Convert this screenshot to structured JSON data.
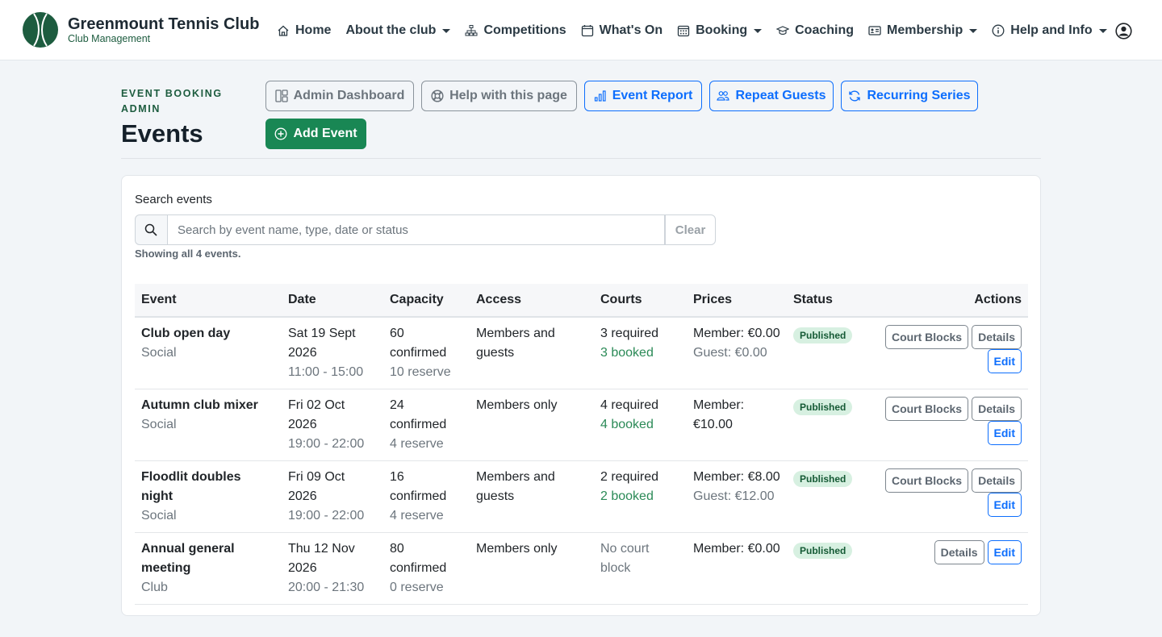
{
  "brand": {
    "title": "Greenmount Tennis Club",
    "subtitle": "Club Management"
  },
  "nav": [
    {
      "label": "Home",
      "icon": "home-icon",
      "dropdown": false
    },
    {
      "label": "About the club",
      "icon": "",
      "dropdown": true
    },
    {
      "label": "Competitions",
      "icon": "sitemap-icon",
      "dropdown": false
    },
    {
      "label": "What's On",
      "icon": "calendar-icon",
      "dropdown": false
    },
    {
      "label": "Booking",
      "icon": "calendar-grid-icon",
      "dropdown": true
    },
    {
      "label": "Coaching",
      "icon": "mortarboard-icon",
      "dropdown": false
    },
    {
      "label": "Membership",
      "icon": "id-card-icon",
      "dropdown": true
    },
    {
      "label": "Help and Info",
      "icon": "info-icon",
      "dropdown": true
    }
  ],
  "header": {
    "eyebrow": "EVENT BOOKING ADMIN",
    "title": "Events",
    "buttons": {
      "admin_dashboard": "Admin Dashboard",
      "help": "Help with this page",
      "event_report": "Event Report",
      "repeat_guests": "Repeat Guests",
      "recurring_series": "Recurring Series",
      "add_event": "Add Event"
    }
  },
  "search": {
    "label": "Search events",
    "placeholder": "Search by event name, type, date or status",
    "value": "",
    "clear": "Clear",
    "summary": "Showing all 4 events."
  },
  "table": {
    "headers": {
      "event": "Event",
      "date": "Date",
      "capacity": "Capacity",
      "access": "Access",
      "courts": "Courts",
      "prices": "Prices",
      "status": "Status",
      "actions": "Actions"
    },
    "rows": [
      {
        "name": "Club open day",
        "type": "Social",
        "date": "Sat 19 Sept 2026",
        "time": "11:00 - 15:00",
        "confirmed": "60 confirmed",
        "reserve": "10 reserve",
        "access": "Members and guests",
        "courts_required": "3 required",
        "courts_booked": "3 booked",
        "price_member": "Member: €0.00",
        "price_guest": "Guest: €0.00",
        "status": "Published",
        "court_blocks": "Court Blocks",
        "details": "Details",
        "edit": "Edit"
      },
      {
        "name": "Autumn club mixer",
        "type": "Social",
        "date": "Fri 02 Oct 2026",
        "time": "19:00 - 22:00",
        "confirmed": "24 confirmed",
        "reserve": "4 reserve",
        "access": "Members only",
        "courts_required": "4 required",
        "courts_booked": "4 booked",
        "price_member": "Member: €10.00",
        "price_guest": "",
        "status": "Published",
        "court_blocks": "Court Blocks",
        "details": "Details",
        "edit": "Edit"
      },
      {
        "name": "Floodlit doubles night",
        "type": "Social",
        "date": "Fri 09 Oct 2026",
        "time": "19:00 - 22:00",
        "confirmed": "16 confirmed",
        "reserve": "4 reserve",
        "access": "Members and guests",
        "courts_required": "2 required",
        "courts_booked": "2 booked",
        "price_member": "Member: €8.00",
        "price_guest": "Guest: €12.00",
        "status": "Published",
        "court_blocks": "Court Blocks",
        "details": "Details",
        "edit": "Edit"
      },
      {
        "name": "Annual general meeting",
        "type": "Club",
        "date": "Thu 12 Nov 2026",
        "time": "20:00 - 21:30",
        "confirmed": "80 confirmed",
        "reserve": "0 reserve",
        "access": "Members only",
        "courts_note": "No court block",
        "price_member": "Member: €0.00",
        "price_guest": "",
        "status": "Published",
        "details": "Details",
        "edit": "Edit"
      }
    ]
  }
}
